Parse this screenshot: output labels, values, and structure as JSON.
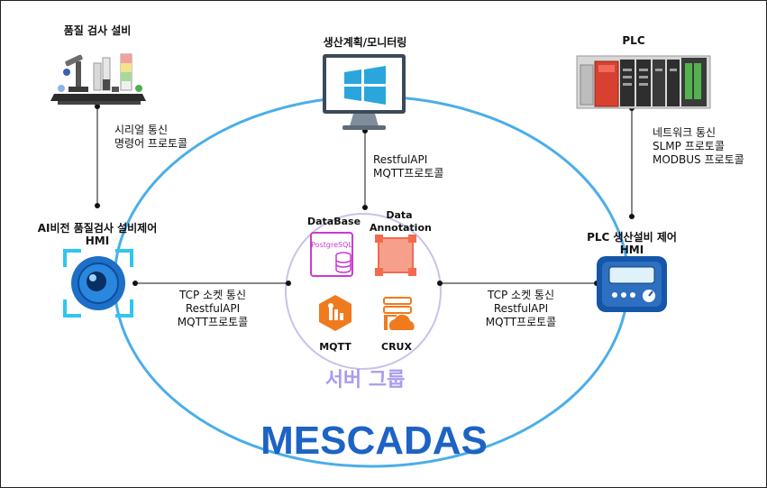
{
  "nodes": {
    "quality_equipment": {
      "title": "품질 검사 설비"
    },
    "production_monitor": {
      "title": "생산계획/모니터링"
    },
    "plc": {
      "title": "PLC"
    },
    "ai_vision_hmi": {
      "line1": "AI비전 품질검사 설비제어",
      "line2": "HMI"
    },
    "plc_hmi": {
      "line1": "PLC 생산설비 제어",
      "line2": "HMI"
    }
  },
  "links": {
    "quality_to_ai": {
      "line1": "시리얼 통신",
      "line2": "명령어 프로토콜"
    },
    "monitor_to_server": {
      "line1": "RestfulAPI",
      "line2": "MQTT프로토콜"
    },
    "plc_to_hmi": {
      "line1": "네트워크 통신",
      "line2": "SLMP 프로토콜",
      "line3": "MODBUS 프로토콜"
    },
    "ai_to_server": {
      "line1": "TCP 소켓 통신",
      "line2": "RestfulAPI",
      "line3": "MQTT프로토콜"
    },
    "server_to_plc": {
      "line1": "TCP 소켓 통신",
      "line2": "RestfulAPI",
      "line3": "MQTT프로토콜"
    }
  },
  "server_group": {
    "title": "서버 그룹",
    "database": {
      "label": "DataBase",
      "icon": "postgresql-database-icon",
      "icon_text": "PostgreSQL"
    },
    "annotation": {
      "line1": "Data",
      "line2": "Annotation"
    },
    "mqtt": {
      "label": "MQTT"
    },
    "crux": {
      "label": "CRUX"
    }
  },
  "system_name": "MESCADAS",
  "colors": {
    "outer_ellipse": "#4aaee8",
    "inner_circle": "#c8c2ea",
    "server_title": "#a99cf0",
    "system_name": "#1d63c4",
    "postgres": "#c93bd0",
    "annotation": "#f26b4f",
    "mqtt": "#f07a1e",
    "crux": "#f07a1e",
    "windows": "#2aa6dd"
  }
}
